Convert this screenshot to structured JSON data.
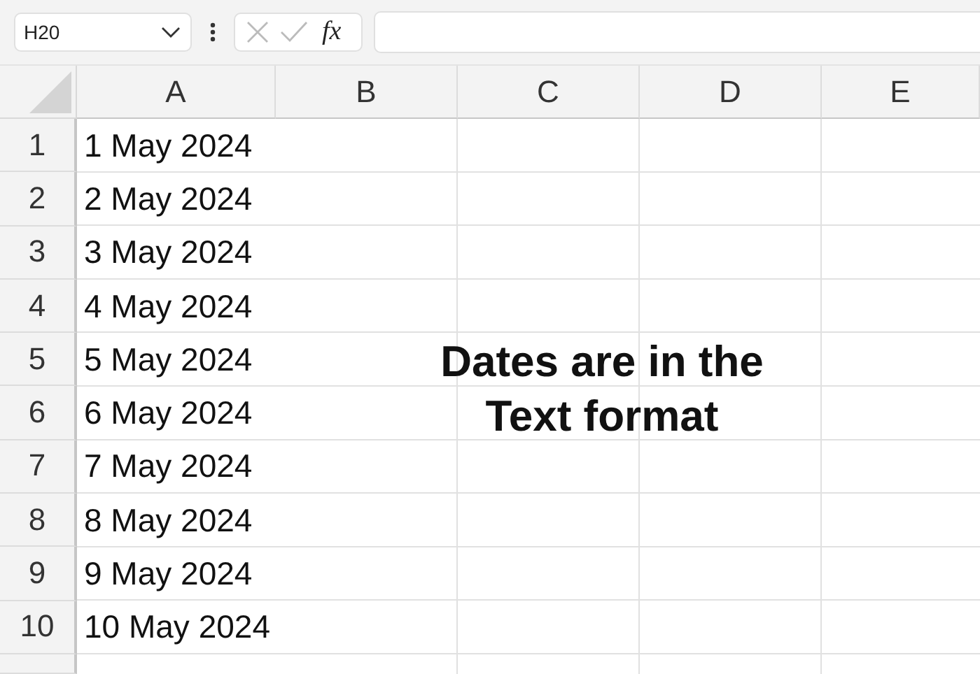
{
  "formula_bar": {
    "name_box": "H20",
    "function_label": "fx"
  },
  "columns": [
    "A",
    "B",
    "C",
    "D",
    "E"
  ],
  "rows": [
    {
      "number": "1",
      "cells": [
        "1 May 2024"
      ]
    },
    {
      "number": "2",
      "cells": [
        "2 May 2024"
      ]
    },
    {
      "number": "3",
      "cells": [
        "3 May 2024"
      ]
    },
    {
      "number": "4",
      "cells": [
        "4 May 2024"
      ]
    },
    {
      "number": "5",
      "cells": [
        "5 May 2024"
      ]
    },
    {
      "number": "6",
      "cells": [
        "6 May 2024"
      ]
    },
    {
      "number": "7",
      "cells": [
        "7 May 2024"
      ]
    },
    {
      "number": "8",
      "cells": [
        "8 May 2024"
      ]
    },
    {
      "number": "9",
      "cells": [
        "9 May 2024"
      ]
    },
    {
      "number": "10",
      "cells": [
        "10 May 2024"
      ]
    }
  ],
  "text_box": {
    "text": "Dates are in the Text format"
  }
}
